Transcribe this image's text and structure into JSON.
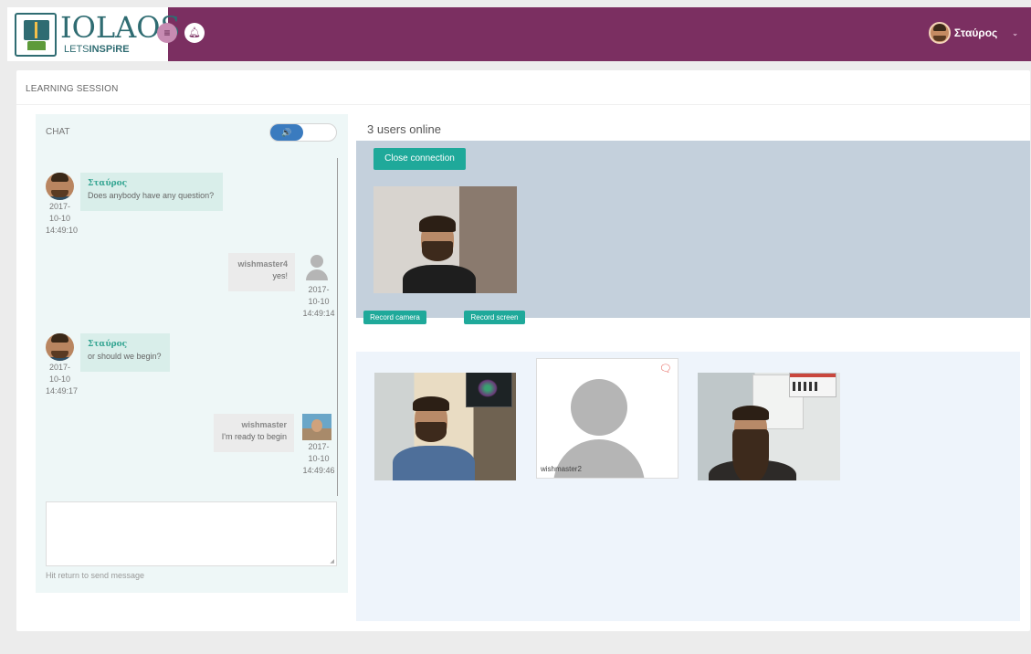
{
  "header": {
    "logo_title": "IOLAOS",
    "logo_sub_lets": "LETS",
    "logo_sub_inspire": "INSPiRE",
    "menu_icon": "hamburger-icon",
    "bell_icon": "bell-icon",
    "user_name": "Σταύρος",
    "user_caret": "⌄"
  },
  "panel": {
    "title": "LEARNING SESSION"
  },
  "chat": {
    "label": "CHAT",
    "sound_icon": "🔊",
    "messages": [
      {
        "name": "Σταύρος",
        "text": "Does anybody have any question?",
        "date": "2017-",
        "date2": "10-10",
        "time": "14:49:10",
        "side": "left"
      },
      {
        "name": "wishmaster4",
        "text": "yes!",
        "date": "2017-",
        "date2": "10-10",
        "time": "14:49:14",
        "side": "right"
      },
      {
        "name": "Σταύρος",
        "text": "or should we begin?",
        "date": "2017-",
        "date2": "10-10",
        "time": "14:49:17",
        "side": "left"
      },
      {
        "name": "wishmaster",
        "text": "I'm ready to begin",
        "date": "2017-",
        "date2": "10-10",
        "time": "14:49:46",
        "side": "right"
      }
    ],
    "input_value": "",
    "hint": "Hit return to send message"
  },
  "video": {
    "online_text": "3 users online",
    "close_button": "Close connection",
    "record_camera": "Record camera",
    "record_screen": "Record screen",
    "peer2_name": "wishmaster2",
    "chat_icon": "🗨"
  },
  "colors": {
    "brand": "#7b2f61",
    "accent": "#1fa99a",
    "chat_name": "#35a592"
  }
}
